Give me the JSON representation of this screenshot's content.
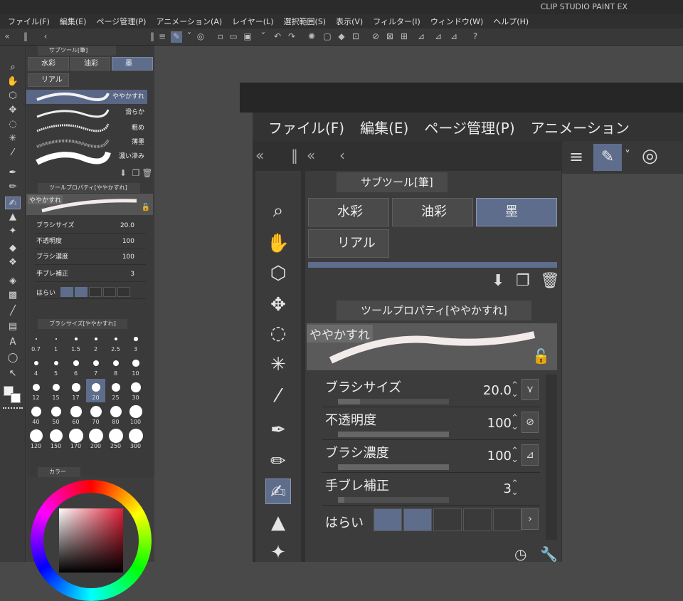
{
  "app": {
    "title": "CLIP STUDIO PAINT EX"
  },
  "menu": [
    "ファイル(F)",
    "編集(E)",
    "ページ管理(P)",
    "アニメーション(A)",
    "レイヤー(L)",
    "選択範囲(S)",
    "表示(V)",
    "フィルター(I)",
    "ウィンドウ(W)",
    "ヘルプ(H)"
  ],
  "subtool": {
    "tab": "サブツール[筆]",
    "groups": [
      "水彩",
      "油彩",
      "墨",
      "リアル"
    ],
    "selected_group": "墨",
    "brushes": [
      "ややかすれ",
      "滑らか",
      "粗め",
      "薄墨",
      "濃い滲み"
    ],
    "selected_brush": "ややかすれ"
  },
  "toolprop": {
    "tab": "ツールプロパティ[ややかすれ]",
    "preview_label": "ややかすれ",
    "rows": [
      {
        "label": "ブラシサイズ",
        "value": "20.0"
      },
      {
        "label": "不透明度",
        "value": "100"
      },
      {
        "label": "ブラシ濃度",
        "value": "100"
      },
      {
        "label": "手ブレ補正",
        "value": "3"
      }
    ],
    "harai": "はらい"
  },
  "brushsize": {
    "tab": "ブラシサイズ[ややかすれ]",
    "sizes": [
      "0.7",
      "1",
      "1.5",
      "2",
      "2.5",
      "3",
      "4",
      "5",
      "6",
      "7",
      "8",
      "10",
      "12",
      "15",
      "17",
      "20",
      "25",
      "30",
      "40",
      "50",
      "60",
      "70",
      "80",
      "100",
      "120",
      "150",
      "170",
      "200",
      "250",
      "300"
    ],
    "selected": "20"
  },
  "color": {
    "tab": "カラー"
  },
  "zoom": {
    "menu": [
      "ファイル(F)",
      "編集(E)",
      "ページ管理(P)",
      "アニメーション"
    ],
    "subtool_tab": "サブツール[筆]",
    "groups": [
      "水彩",
      "油彩",
      "墨",
      "リアル"
    ],
    "toolprop_tab": "ツールプロパティ[ややかすれ]",
    "preview_label": "ややかすれ",
    "rows": [
      {
        "label": "ブラシサイズ",
        "value": "20.0"
      },
      {
        "label": "不透明度",
        "value": "100"
      },
      {
        "label": "ブラシ濃度",
        "value": "100"
      },
      {
        "label": "手ブレ補正",
        "value": "3"
      }
    ],
    "harai": "はらい"
  },
  "colors": {
    "accent": "#5f6d8d",
    "panel": "#3a3a3a",
    "background": "#494949"
  }
}
